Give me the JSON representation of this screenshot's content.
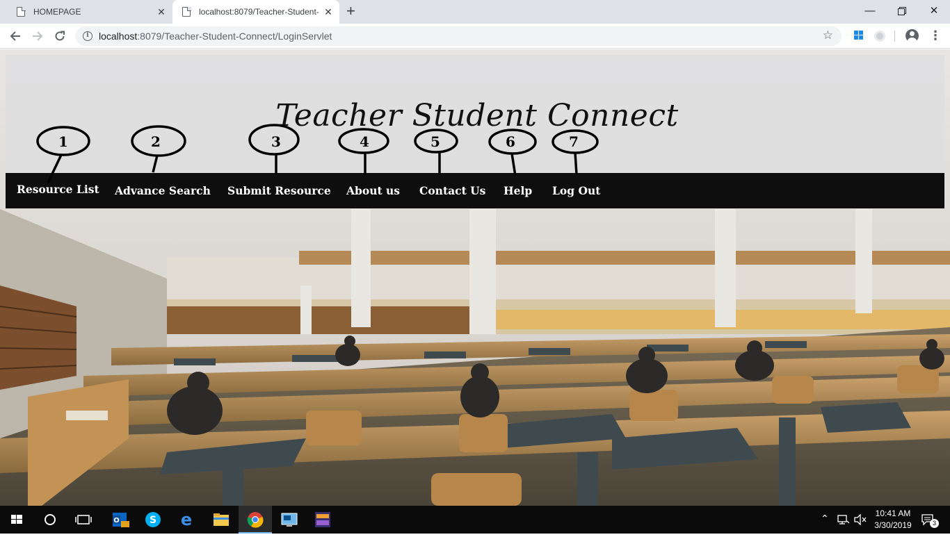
{
  "browser": {
    "tabs": [
      {
        "title": "HOMEPAGE",
        "active": false
      },
      {
        "title": "localhost:8079/Teacher-Student-",
        "active": true
      }
    ],
    "url_host": "localhost",
    "url_rest": ":8079/Teacher-Student-Connect/LoginServlet",
    "icons": [
      "page-icon",
      "close-icon",
      "new-tab-icon",
      "back-icon",
      "forward-icon",
      "reload-icon",
      "info-icon",
      "star-icon",
      "windows-extension-icon",
      "extension-icon",
      "profile-icon",
      "menu-icon",
      "minimize-icon",
      "restore-icon",
      "window-close-icon"
    ]
  },
  "site": {
    "title": "Teacher Student Connect",
    "nav": [
      {
        "label": "Resource List",
        "marker": "1"
      },
      {
        "label": "Advance Search",
        "marker": "2"
      },
      {
        "label": "Submit Resource",
        "marker": "3"
      },
      {
        "label": "About us",
        "marker": "4"
      },
      {
        "label": "Contact Us",
        "marker": "5"
      },
      {
        "label": "Help",
        "marker": "6"
      },
      {
        "label": "Log Out",
        "marker": "7"
      }
    ],
    "background": "library reading room photo"
  },
  "taskbar": {
    "apps": [
      "start-icon",
      "cortana-icon",
      "task-view-icon",
      "outlook-icon",
      "skype-icon",
      "edge-icon",
      "file-explorer-icon",
      "chrome-icon",
      "remote-desktop-icon",
      "app-icon"
    ],
    "time": "10:41 AM",
    "date": "3/30/2019",
    "notification_count": "3"
  },
  "colors": {
    "navbar": "#0e0e0e",
    "tab_strip": "#dee1e6",
    "taskbar": "#0b0b0b"
  }
}
